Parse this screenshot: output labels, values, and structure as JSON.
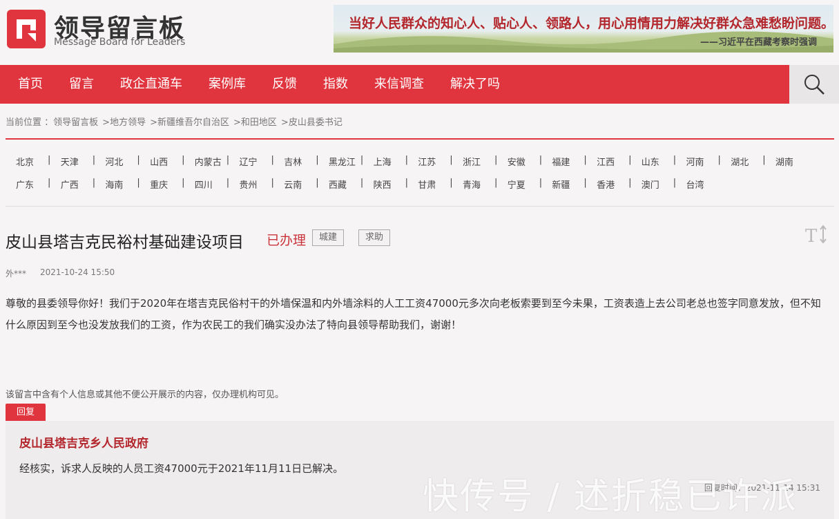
{
  "header": {
    "logo_title": "领导留言板",
    "logo_subtitle": "Message Board for Leaders",
    "banner_quote": "当好人民群众的知心人、贴心人、领路人，用心用情用力解决好群众急难愁盼问题。",
    "banner_source": "——习近平在西藏考察时强调"
  },
  "nav": {
    "items": [
      "首页",
      "留言",
      "政企直通车",
      "案例库",
      "反馈",
      "指数",
      "来信调查",
      "解决了吗"
    ],
    "search_icon": "search-icon"
  },
  "breadcrumb": {
    "label": "当前位置 ：",
    "items": [
      "领导留言板",
      "地方领导",
      "新疆维吾尔自治区",
      "和田地区",
      "皮山县委书记"
    ],
    "separator": ">"
  },
  "regions": {
    "row1": [
      "北京",
      "天津",
      "河北",
      "山西",
      "内蒙古",
      "辽宁",
      "吉林",
      "黑龙江",
      "上海",
      "江苏",
      "浙江",
      "安徽",
      "福建",
      "江西",
      "山东",
      "河南",
      "湖北",
      "湖南"
    ],
    "row2": [
      "广东",
      "广西",
      "海南",
      "重庆",
      "四川",
      "贵州",
      "云南",
      "西藏",
      "陕西",
      "甘肃",
      "青海",
      "宁夏",
      "新疆",
      "香港",
      "澳门",
      "台湾"
    ],
    "separator": "|"
  },
  "message": {
    "title": "皮山县塔吉克民裕村基础建设项目",
    "status": "已办理",
    "tags": [
      "城建",
      "求助"
    ],
    "author": "外***",
    "date": "2021-10-24 15:50",
    "body": "尊敬的县委领导你好！我们于2020年在塔吉克民俗村干的外墙保温和内外墙涂料的人工工资47000元多次向老板索要到至今未果，工资表造上去公司老总也签字同意发放，但不知什么原因到至今也没发放我们的工资，作为农民工的我们确实没办法了特向县领导帮助我们，谢谢！",
    "privacy_note": "该留言中含有个人信息或其他不便公开展示的内容，仅办理机构可见。"
  },
  "reply": {
    "badge": "回复",
    "org": "皮山县塔吉克乡人民政府",
    "text": "经核实，诉求人反映的人员工资47000元于2021年11月11日已解决。",
    "time": "回复时间：2021-11-14 15:31"
  },
  "watermark": "快传号 / 述折稳已许派",
  "colors": {
    "accent": "#e0353e",
    "dark_red": "#b2262c"
  }
}
